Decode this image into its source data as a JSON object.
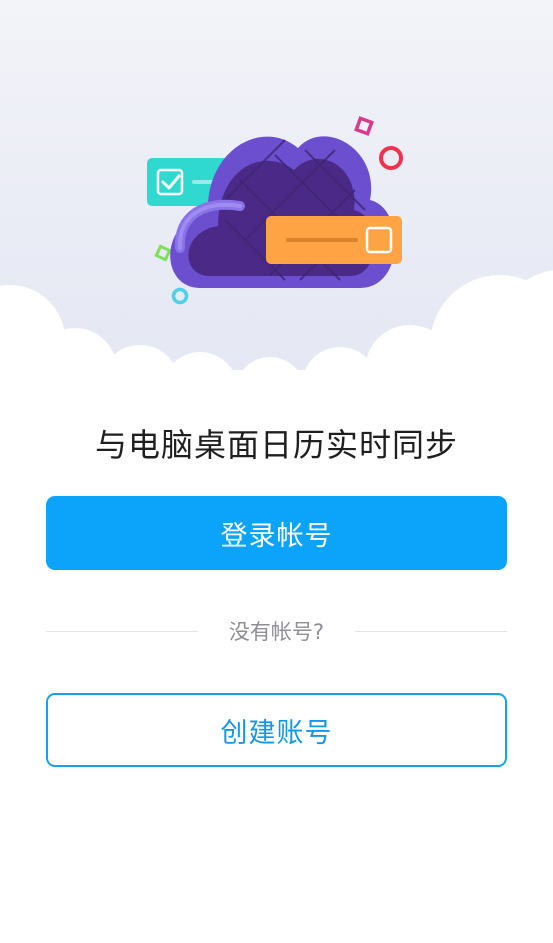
{
  "illustration": {
    "icons": [
      "cloud-icon",
      "checkbox-card-icon",
      "orange-card-icon"
    ],
    "colors": {
      "cloud_outer": "#6b4fcf",
      "cloud_inner": "#4a2a86",
      "card_teal": "#2fd9cf",
      "card_orange": "#ffa345",
      "accent_pink": "#d63b8c",
      "accent_red": "#f0324f",
      "accent_green": "#7de057",
      "accent_cyan": "#4fd1e8"
    }
  },
  "headline": "与电脑桌面日历实时同步",
  "login_button": "登录帐号",
  "divider": {
    "text": "没有帐号?"
  },
  "create_button": "创建账号",
  "colors": {
    "primary": "#0ca4fb",
    "secondary_border": "#12a3ed",
    "headline": "#1f1f1f",
    "muted": "#8e8f96"
  }
}
